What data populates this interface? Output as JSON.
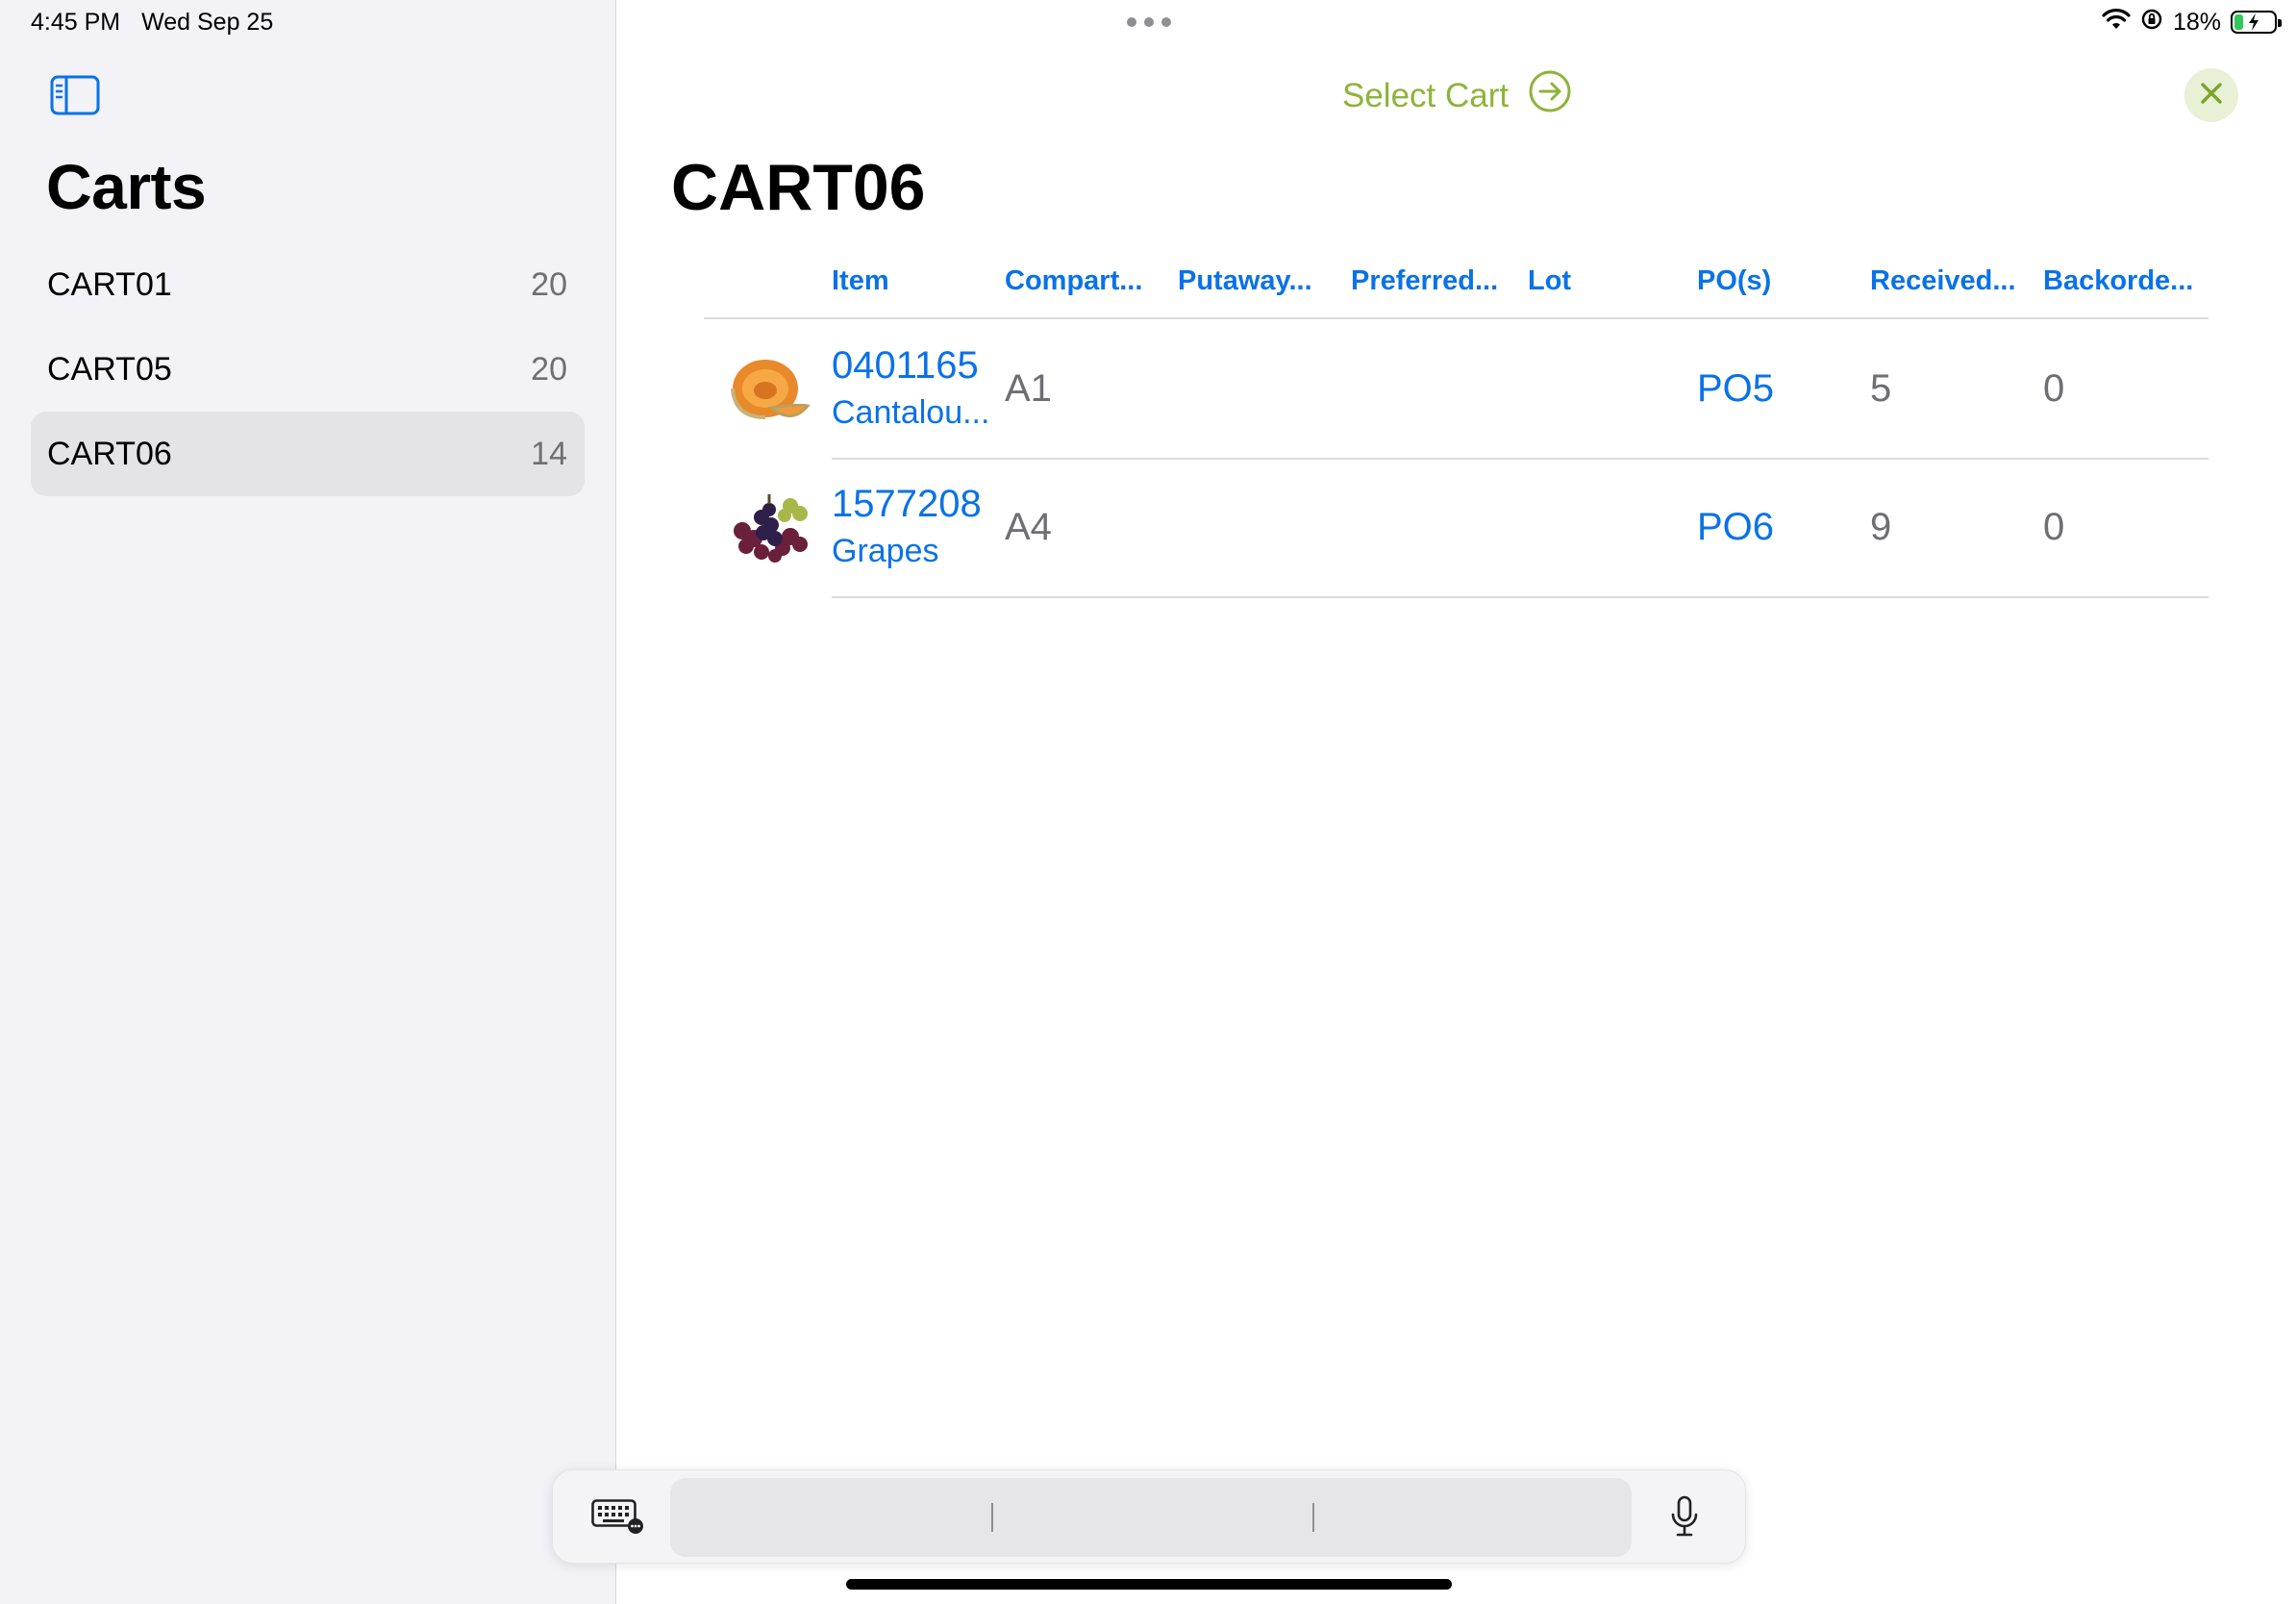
{
  "status_bar": {
    "time": "4:45 PM",
    "date": "Wed Sep 25",
    "battery": "18%",
    "icons": [
      "wifi-icon",
      "orientation-lock-icon",
      "battery-charging-icon"
    ]
  },
  "sidebar": {
    "title": "Carts",
    "toggle_icon": "sidebar-toggle-icon",
    "items": [
      {
        "label": "CART01",
        "count": "20",
        "selected": false
      },
      {
        "label": "CART05",
        "count": "20",
        "selected": false
      },
      {
        "label": "CART06",
        "count": "14",
        "selected": true
      }
    ]
  },
  "header": {
    "select_cart_label": "Select Cart",
    "select_cart_icon": "arrow-right-circle-icon",
    "close_icon": "close-icon",
    "title": "CART06"
  },
  "table": {
    "columns": [
      "Item",
      "Compart...",
      "Putaway...",
      "Preferred...",
      "Lot",
      "PO(s)",
      "Received...",
      "Backorde..."
    ],
    "rows": [
      {
        "image": "cantaloupe-image",
        "item_number": "0401165",
        "item_name": "Cantalou...",
        "compartment": "A1",
        "putaway": "",
        "preferred": "",
        "lot": "",
        "po": "PO5",
        "received": "5",
        "backorder": "0"
      },
      {
        "image": "grapes-image",
        "item_number": "1577208",
        "item_name": "Grapes",
        "compartment": "A4",
        "putaway": "",
        "preferred": "",
        "lot": "",
        "po": "PO6",
        "received": "9",
        "backorder": "0"
      }
    ]
  },
  "colors": {
    "accent_blue": "#0a72e8",
    "accent_green": "#8db43a",
    "sidebar_bg": "#f2f2f7",
    "selected_row_bg": "#e3e3e8"
  }
}
